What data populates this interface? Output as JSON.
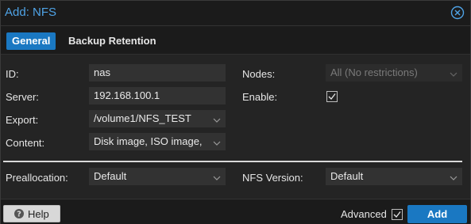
{
  "window": {
    "title": "Add: NFS",
    "close_icon": "close-circle-icon"
  },
  "tabs": [
    {
      "label": "General",
      "active": true
    },
    {
      "label": "Backup Retention",
      "active": false
    }
  ],
  "form": {
    "id": {
      "label": "ID:",
      "value": "nas"
    },
    "server": {
      "label": "Server:",
      "value": "192.168.100.1"
    },
    "export": {
      "label": "Export:",
      "value": "/volume1/NFS_TEST"
    },
    "content": {
      "label": "Content:",
      "value": "Disk image, ISO image,"
    },
    "nodes": {
      "label": "Nodes:",
      "value": "All (No restrictions)",
      "disabled": true
    },
    "enable": {
      "label": "Enable:",
      "checked": true
    },
    "preallocation": {
      "label": "Preallocation:",
      "value": "Default"
    },
    "nfs_version": {
      "label": "NFS Version:",
      "value": "Default"
    }
  },
  "footer": {
    "help_label": "Help",
    "advanced_label": "Advanced",
    "advanced_checked": true,
    "add_label": "Add"
  },
  "colors": {
    "accent": "#1a78c2",
    "title": "#4fa3e6",
    "background": "#242424"
  }
}
